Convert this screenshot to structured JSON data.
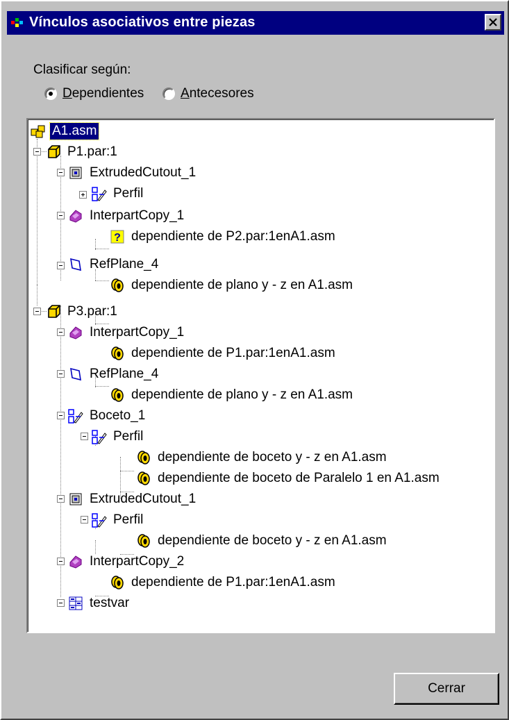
{
  "window": {
    "title": "Vínculos asociativos entre piezas",
    "close_glyph": "×"
  },
  "sort": {
    "label": "Clasificar según:",
    "options": [
      {
        "label": "Dependientes",
        "underline": "D",
        "rest": "ependientes",
        "checked": true
      },
      {
        "label": "Antecesores",
        "underline": "A",
        "rest": "ntecesores",
        "checked": false
      }
    ]
  },
  "tree": {
    "root": {
      "label": "A1.asm",
      "icon": "assembly-icon",
      "selected": true
    },
    "nodes": [
      {
        "label": "P1.par:1",
        "icon": "part-icon"
      },
      {
        "label": "ExtrudedCutout_1",
        "icon": "extruded-cutout-icon"
      },
      {
        "label": "Perfil",
        "icon": "sketch-profile-icon"
      },
      {
        "label": "InterpartCopy_1",
        "icon": "interpart-copy-icon"
      },
      {
        "label": "dependiente de P2.par:1enA1.asm",
        "icon": "unknown-link-icon"
      },
      {
        "label": "RefPlane_4",
        "icon": "ref-plane-icon"
      },
      {
        "label": "dependiente de plano y - z en A1.asm",
        "icon": "link-icon"
      },
      {
        "label": "P3.par:1",
        "icon": "part-icon"
      },
      {
        "label": "InterpartCopy_1",
        "icon": "interpart-copy-icon"
      },
      {
        "label": "dependiente de P1.par:1enA1.asm",
        "icon": "link-icon"
      },
      {
        "label": "RefPlane_4",
        "icon": "ref-plane-icon"
      },
      {
        "label": "dependiente de plano y - z en A1.asm",
        "icon": "link-icon"
      },
      {
        "label": "Boceto_1",
        "icon": "sketch-profile-icon"
      },
      {
        "label": "Perfil",
        "icon": "sketch-profile-icon"
      },
      {
        "label": "dependiente de boceto y - z en A1.asm",
        "icon": "link-icon"
      },
      {
        "label": "dependiente de boceto de Paralelo 1 en A1.asm",
        "icon": "link-icon"
      },
      {
        "label": "ExtrudedCutout_1",
        "icon": "extruded-cutout-icon"
      },
      {
        "label": "Perfil",
        "icon": "sketch-profile-icon"
      },
      {
        "label": "dependiente de boceto y - z en A1.asm",
        "icon": "link-icon"
      },
      {
        "label": "InterpartCopy_2",
        "icon": "interpart-copy-icon"
      },
      {
        "label": "dependiente de P1.par:1enA1.asm",
        "icon": "link-icon"
      },
      {
        "label": "testvar",
        "icon": "variable-table-icon"
      }
    ]
  },
  "footer": {
    "close_label": "Cerrar"
  },
  "colors": {
    "title_bar": "#000080",
    "face": "#c0c0c0",
    "selection": "#000080"
  }
}
